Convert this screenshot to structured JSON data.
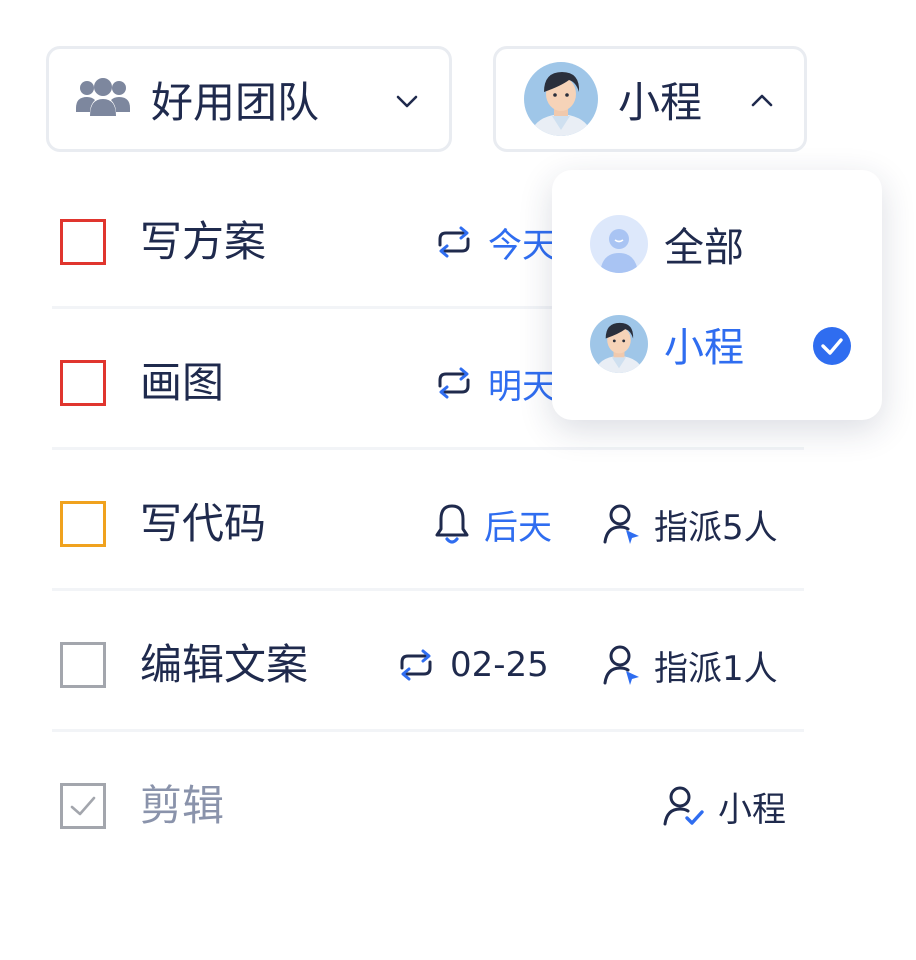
{
  "team_selector": {
    "label": "好用团队",
    "icon": "team-icon",
    "chevron": "chevron-down-icon"
  },
  "user_selector": {
    "label": "小程",
    "icon": "avatar",
    "chevron": "chevron-up-icon"
  },
  "tasks": [
    {
      "title": "写方案",
      "checkbox_color": "#e0352e",
      "checked": false,
      "due": "今天",
      "due_icon": "repeat-icon",
      "due_color": "#2f6df0",
      "assignee": ""
    },
    {
      "title": "画图",
      "checkbox_color": "#e0352e",
      "checked": false,
      "due": "明天",
      "due_icon": "repeat-icon",
      "due_color": "#2f6df0",
      "assignee": ""
    },
    {
      "title": "写代码",
      "checkbox_color": "#f0a21e",
      "checked": false,
      "due": "后天",
      "due_icon": "bell-icon",
      "due_color": "#2f6df0",
      "assignee": "指派5人",
      "assignee_icon": "assign-user-icon"
    },
    {
      "title": "编辑文案",
      "checkbox_color": "#a3a6ad",
      "checked": false,
      "due": "02-25",
      "due_icon": "repeat-icon",
      "due_color": "#1f2a4d",
      "assignee": "指派1人",
      "assignee_icon": "assign-user-icon"
    },
    {
      "title": "剪辑",
      "checkbox_color": "#a3a6ad",
      "checked": true,
      "due": "",
      "assignee": "小程",
      "assignee_icon": "user-check-icon"
    }
  ],
  "dropdown": {
    "options": [
      {
        "label": "全部",
        "icon": "default-avatar-icon",
        "selected": false
      },
      {
        "label": "小程",
        "icon": "avatar",
        "selected": true
      }
    ]
  },
  "colors": {
    "accent": "#2f6df0",
    "text": "#1f2a4d",
    "muted": "#8a93ab"
  }
}
